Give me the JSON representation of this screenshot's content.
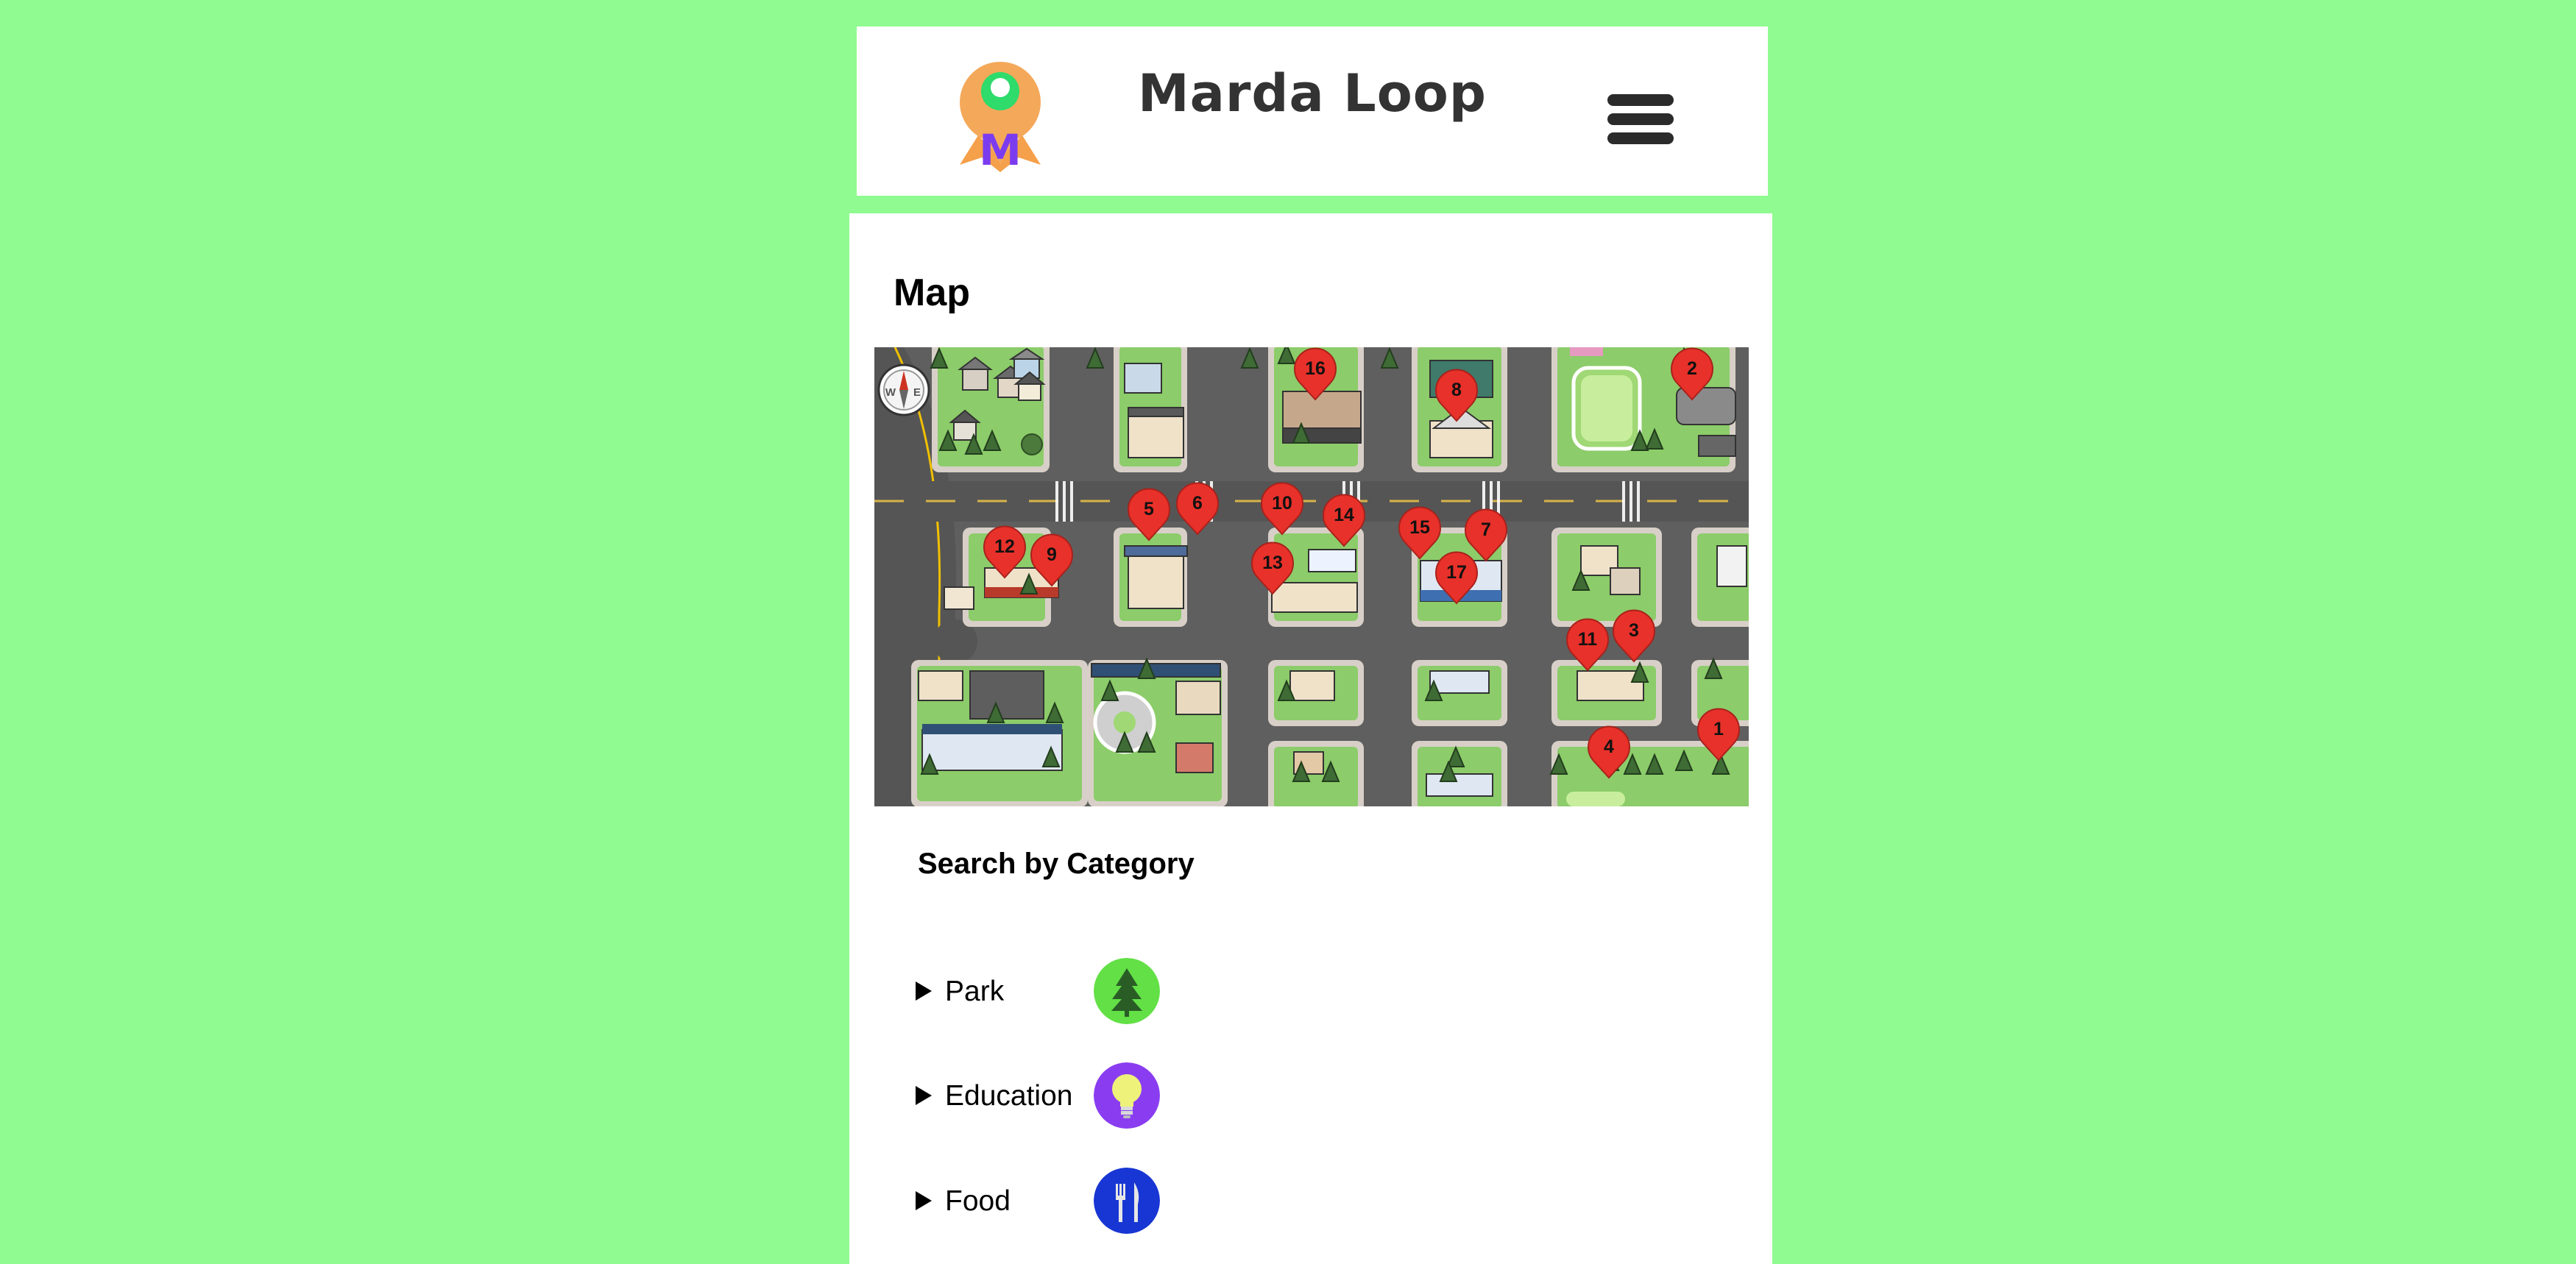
{
  "header": {
    "logo_letter": "M",
    "title": "Marda Loop"
  },
  "main": {
    "section_title": "Map",
    "map": {
      "compass_labels": [
        "N",
        "W",
        "E"
      ],
      "markers": [
        "1",
        "2",
        "3",
        "4",
        "5",
        "6",
        "7",
        "8",
        "9",
        "10",
        "11",
        "12",
        "13",
        "14",
        "15",
        "16",
        "17"
      ]
    },
    "search_title": "Search by Category",
    "categories": [
      {
        "label": "Park",
        "icon": "tree-icon",
        "color": "#62e046"
      },
      {
        "label": "Education",
        "icon": "lightbulb-icon",
        "color": "#8a3df0"
      },
      {
        "label": "Food",
        "icon": "fork-knife-icon",
        "color": "#1836d4"
      }
    ]
  },
  "colors": {
    "page_background": "#90fb91",
    "marker": "#e8312a",
    "title_text": "#333333"
  }
}
